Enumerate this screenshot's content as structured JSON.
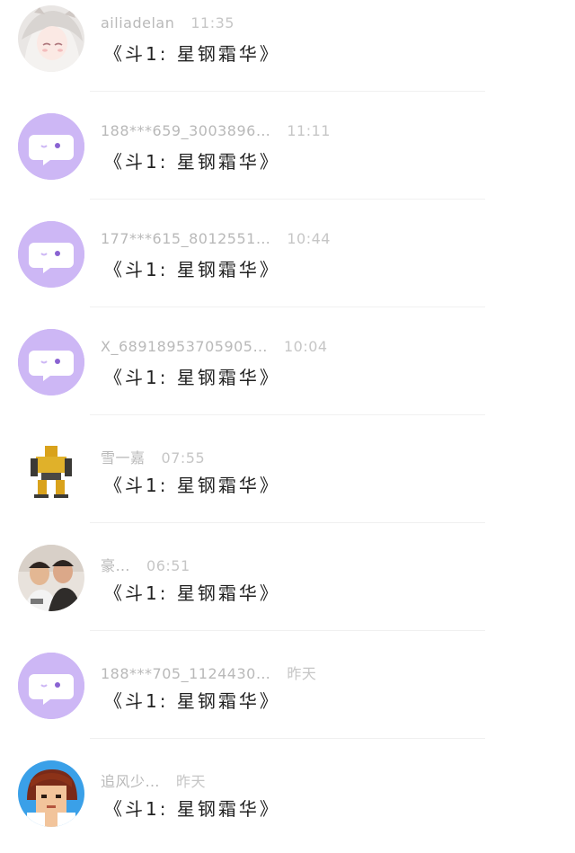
{
  "theme": {
    "default_avatar_bg": "#cdb7f5",
    "meta_color": "#b9b9b9",
    "text_color": "#222222"
  },
  "messages": [
    {
      "user": "ailiadelan",
      "time": "11:35",
      "text": "《斗1: 星钢霜华》",
      "avatar": "anime-portrait"
    },
    {
      "user": "188***659_3003896…",
      "time": "11:11",
      "text": "《斗1: 星钢霜华》",
      "avatar": "default-chat-avatar"
    },
    {
      "user": "177***615_8012551…",
      "time": "10:44",
      "text": "《斗1: 星钢霜华》",
      "avatar": "default-chat-avatar"
    },
    {
      "user": "X_68918953705905…",
      "time": "10:04",
      "text": "《斗1: 星钢霜华》",
      "avatar": "default-chat-avatar"
    },
    {
      "user": "雪一嘉",
      "time": "07:55",
      "text": "《斗1: 星钢霜华》",
      "avatar": "robot-figure"
    },
    {
      "user": "豪…",
      "time": "06:51",
      "text": "《斗1: 星钢霜华》",
      "avatar": "two-people-photo"
    },
    {
      "user": "188***705_1124430…",
      "time": "昨天",
      "text": "《斗1: 星钢霜华》",
      "avatar": "default-chat-avatar"
    },
    {
      "user": "追风少…",
      "time": "昨天",
      "text": "《斗1: 星钢霜华》",
      "avatar": "pixel-portrait"
    }
  ]
}
